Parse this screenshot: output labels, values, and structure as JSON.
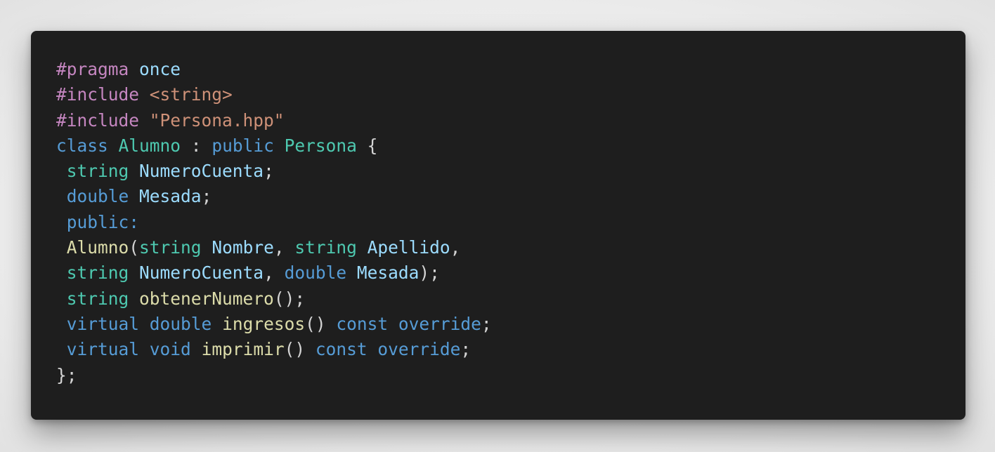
{
  "colors": {
    "background": "#ececec",
    "card": "#1e1e1e",
    "directive": "#c586c0",
    "keyword": "#569cd6",
    "type": "#4ec9b0",
    "identifier": "#9cdcfe",
    "string": "#ce9178",
    "function": "#dcdcaa",
    "punctuation": "#d4d4d4"
  },
  "code": {
    "language": "cpp",
    "lines": [
      [
        {
          "t": "#pragma",
          "k": "directive"
        },
        {
          "t": " ",
          "k": "punct"
        },
        {
          "t": "once",
          "k": "ident"
        }
      ],
      [
        {
          "t": "#include",
          "k": "directive"
        },
        {
          "t": " ",
          "k": "punct"
        },
        {
          "t": "<string>",
          "k": "string"
        }
      ],
      [
        {
          "t": "#include",
          "k": "directive"
        },
        {
          "t": " ",
          "k": "punct"
        },
        {
          "t": "\"Persona.hpp\"",
          "k": "string"
        }
      ],
      [
        {
          "t": "class",
          "k": "keyword"
        },
        {
          "t": " ",
          "k": "punct"
        },
        {
          "t": "Alumno",
          "k": "type"
        },
        {
          "t": " : ",
          "k": "punct"
        },
        {
          "t": "public",
          "k": "keyword"
        },
        {
          "t": " ",
          "k": "punct"
        },
        {
          "t": "Persona",
          "k": "type"
        },
        {
          "t": " {",
          "k": "punct"
        }
      ],
      [
        {
          "t": " ",
          "k": "punct"
        },
        {
          "t": "string",
          "k": "type"
        },
        {
          "t": " ",
          "k": "punct"
        },
        {
          "t": "NumeroCuenta",
          "k": "ident"
        },
        {
          "t": ";",
          "k": "punct"
        }
      ],
      [
        {
          "t": " ",
          "k": "punct"
        },
        {
          "t": "double",
          "k": "keyword"
        },
        {
          "t": " ",
          "k": "punct"
        },
        {
          "t": "Mesada",
          "k": "ident"
        },
        {
          "t": ";",
          "k": "punct"
        }
      ],
      [
        {
          "t": " ",
          "k": "punct"
        },
        {
          "t": "public:",
          "k": "keyword"
        }
      ],
      [
        {
          "t": " ",
          "k": "punct"
        },
        {
          "t": "Alumno",
          "k": "func"
        },
        {
          "t": "(",
          "k": "punct"
        },
        {
          "t": "string",
          "k": "type"
        },
        {
          "t": " ",
          "k": "punct"
        },
        {
          "t": "Nombre",
          "k": "ident"
        },
        {
          "t": ", ",
          "k": "punct"
        },
        {
          "t": "string",
          "k": "type"
        },
        {
          "t": " ",
          "k": "punct"
        },
        {
          "t": "Apellido",
          "k": "ident"
        },
        {
          "t": ",",
          "k": "punct"
        }
      ],
      [
        {
          "t": " ",
          "k": "punct"
        },
        {
          "t": "string",
          "k": "type"
        },
        {
          "t": " ",
          "k": "punct"
        },
        {
          "t": "NumeroCuenta",
          "k": "ident"
        },
        {
          "t": ", ",
          "k": "punct"
        },
        {
          "t": "double",
          "k": "keyword"
        },
        {
          "t": " ",
          "k": "punct"
        },
        {
          "t": "Mesada",
          "k": "ident"
        },
        {
          "t": ");",
          "k": "punct"
        }
      ],
      [
        {
          "t": " ",
          "k": "punct"
        },
        {
          "t": "string",
          "k": "type"
        },
        {
          "t": " ",
          "k": "punct"
        },
        {
          "t": "obtenerNumero",
          "k": "func"
        },
        {
          "t": "();",
          "k": "punct"
        }
      ],
      [
        {
          "t": " ",
          "k": "punct"
        },
        {
          "t": "virtual",
          "k": "keyword"
        },
        {
          "t": " ",
          "k": "punct"
        },
        {
          "t": "double",
          "k": "keyword"
        },
        {
          "t": " ",
          "k": "punct"
        },
        {
          "t": "ingresos",
          "k": "func"
        },
        {
          "t": "() ",
          "k": "punct"
        },
        {
          "t": "const",
          "k": "keyword"
        },
        {
          "t": " ",
          "k": "punct"
        },
        {
          "t": "override",
          "k": "keyword"
        },
        {
          "t": ";",
          "k": "punct"
        }
      ],
      [
        {
          "t": " ",
          "k": "punct"
        },
        {
          "t": "virtual",
          "k": "keyword"
        },
        {
          "t": " ",
          "k": "punct"
        },
        {
          "t": "void",
          "k": "keyword"
        },
        {
          "t": " ",
          "k": "punct"
        },
        {
          "t": "imprimir",
          "k": "func"
        },
        {
          "t": "() ",
          "k": "punct"
        },
        {
          "t": "const",
          "k": "keyword"
        },
        {
          "t": " ",
          "k": "punct"
        },
        {
          "t": "override",
          "k": "keyword"
        },
        {
          "t": ";",
          "k": "punct"
        }
      ],
      [
        {
          "t": "};",
          "k": "punct"
        }
      ]
    ]
  }
}
